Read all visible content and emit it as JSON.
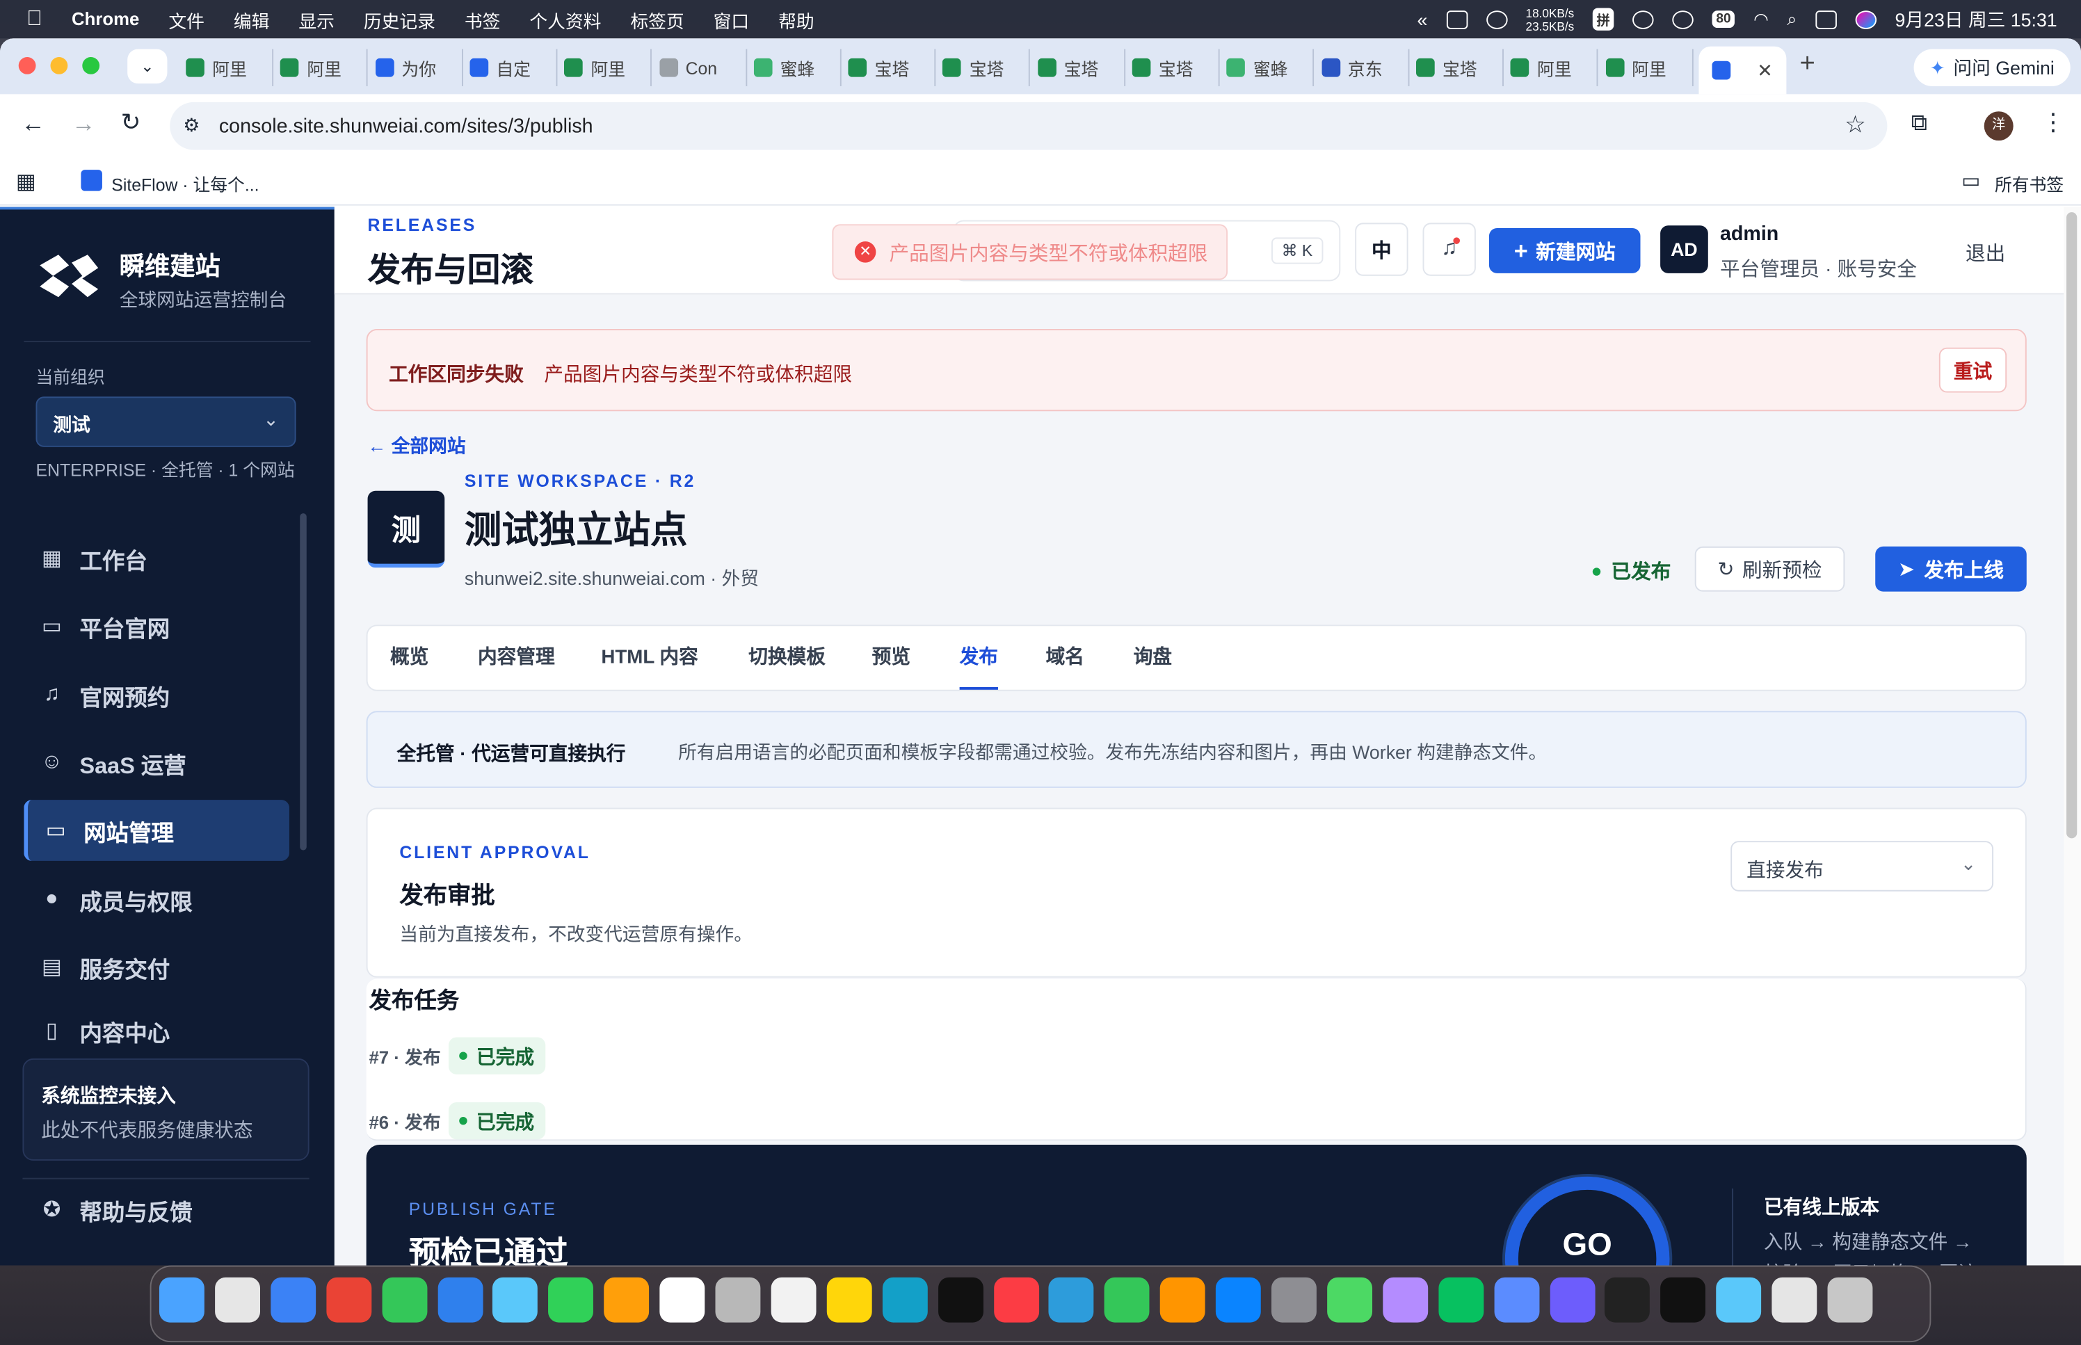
{
  "menubar": {
    "items": [
      "Chrome",
      "文件",
      "编辑",
      "显示",
      "历史记录",
      "书签",
      "个人资料",
      "标签页",
      "窗口",
      "帮助"
    ],
    "net_up": "18.0KB/s",
    "net_down": "23.5KB/s",
    "ime": "拼",
    "battery": "80",
    "datetime": "9月23日 周三  15:31"
  },
  "browser": {
    "tabs": [
      "阿里",
      "阿里",
      "为你",
      "自定",
      "阿里",
      "Con",
      "蜜蜂",
      "宝塔",
      "宝塔",
      "宝塔",
      "宝塔",
      "蜜蜂",
      "京东",
      "宝塔",
      "阿里",
      "阿里"
    ],
    "new_tab": "+",
    "gemini": "问问 Gemini",
    "url": "console.site.shunweiai.com/sites/3/publish",
    "profile": "洋",
    "bookmark": "SiteFlow · 让每个...",
    "all_bookmarks": "所有书签"
  },
  "sidebar": {
    "brand_title": "瞬维建站",
    "brand_subtitle": "全球网站运营控制台",
    "org_label": "当前组织",
    "org_value": "测试",
    "org_meta": "ENTERPRISE · 全托管 · 1 个网站",
    "nav": [
      "工作台",
      "平台官网",
      "官网预约",
      "SaaS 运营",
      "网站管理",
      "成员与权限",
      "服务交付",
      "内容中心"
    ],
    "monitor_title": "系统监控未接入",
    "monitor_desc": "此处不代表服务健康状态",
    "help": "帮助与反馈"
  },
  "topbar": {
    "eyebrow": "RELEASES",
    "title": "发布与回滚",
    "toast": "产品图片内容与类型不符或体积超限",
    "shortcut": "⌘ K",
    "lang": "中",
    "new_site": "新建网站",
    "avatar": "AD",
    "user_name": "admin",
    "user_role": "平台管理员 · 账号安全",
    "logout": "退出"
  },
  "alert": {
    "title": "工作区同步失败",
    "message": "产品图片内容与类型不符或体积超限",
    "retry": "重试"
  },
  "back_link": "全部网站",
  "site": {
    "eyebrow": "SITE WORKSPACE · R2",
    "avatar": "测",
    "name": "测试独立站点",
    "meta": "shunwei2.site.shunweiai.com · 外贸",
    "status": "已发布",
    "refresh": "刷新预检",
    "publish": "发布上线"
  },
  "tabs": [
    "概览",
    "内容管理",
    "HTML 内容",
    "切换模板",
    "预览",
    "发布",
    "域名",
    "询盘"
  ],
  "notice": {
    "title": "全托管 · 代运营可直接执行",
    "text": "所有启用语言的必配页面和模板字段都需通过校验。发布先冻结内容和图片，再由 Worker 构建静态文件。"
  },
  "approval": {
    "eyebrow": "CLIENT APPROVAL",
    "title": "发布审批",
    "desc": "当前为直接发布，不改变代运营原有操作。",
    "select": "直接发布"
  },
  "jobs": {
    "title": "发布任务",
    "items": [
      {
        "label": "#7 · 发布",
        "status": "已完成"
      },
      {
        "label": "#6 · 发布",
        "status": "已完成"
      }
    ]
  },
  "gate": {
    "eyebrow": "PUBLISH GATE",
    "title": "预检已通过",
    "ring": "GO",
    "side_title": "已有线上版本",
    "side_text": "入队 → 构建静态文件 →",
    "side_text2": "校验 → 原子切换 → 回滚"
  }
}
